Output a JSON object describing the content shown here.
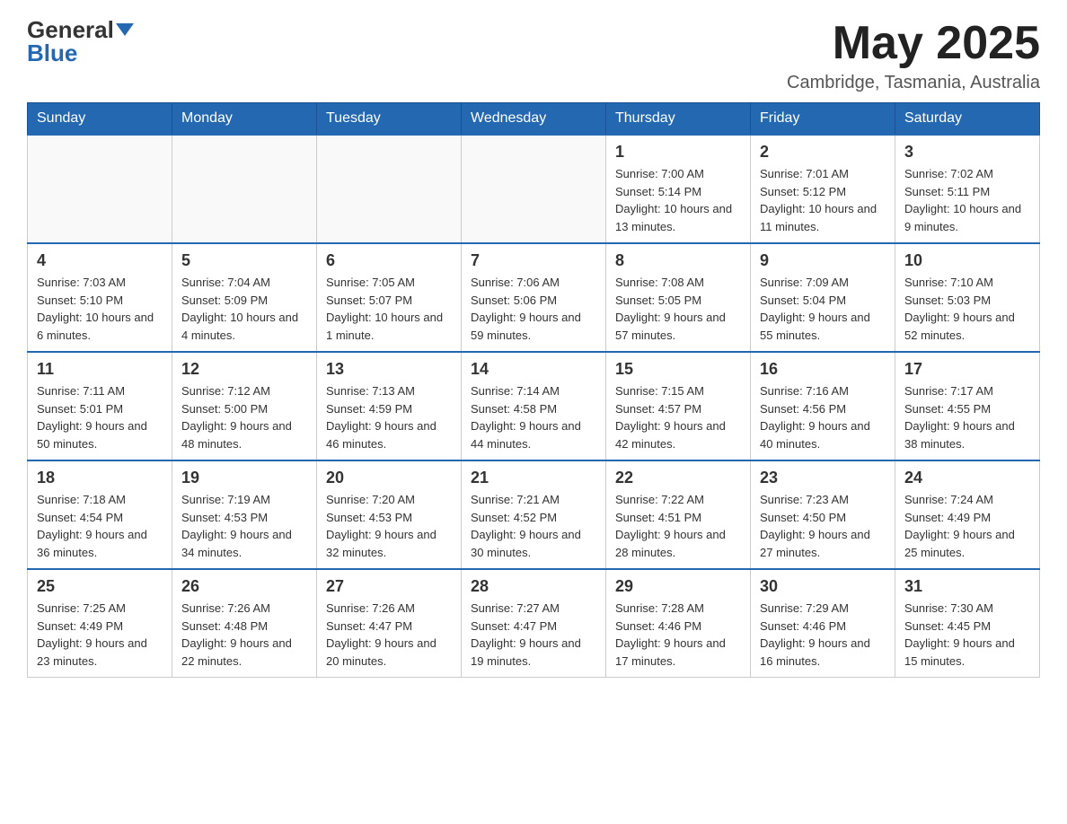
{
  "header": {
    "logo_general": "General",
    "logo_blue": "Blue",
    "month_title": "May 2025",
    "location": "Cambridge, Tasmania, Australia"
  },
  "days_of_week": [
    "Sunday",
    "Monday",
    "Tuesday",
    "Wednesday",
    "Thursday",
    "Friday",
    "Saturday"
  ],
  "weeks": [
    [
      {
        "day": "",
        "info": ""
      },
      {
        "day": "",
        "info": ""
      },
      {
        "day": "",
        "info": ""
      },
      {
        "day": "",
        "info": ""
      },
      {
        "day": "1",
        "info": "Sunrise: 7:00 AM\nSunset: 5:14 PM\nDaylight: 10 hours and 13 minutes."
      },
      {
        "day": "2",
        "info": "Sunrise: 7:01 AM\nSunset: 5:12 PM\nDaylight: 10 hours and 11 minutes."
      },
      {
        "day": "3",
        "info": "Sunrise: 7:02 AM\nSunset: 5:11 PM\nDaylight: 10 hours and 9 minutes."
      }
    ],
    [
      {
        "day": "4",
        "info": "Sunrise: 7:03 AM\nSunset: 5:10 PM\nDaylight: 10 hours and 6 minutes."
      },
      {
        "day": "5",
        "info": "Sunrise: 7:04 AM\nSunset: 5:09 PM\nDaylight: 10 hours and 4 minutes."
      },
      {
        "day": "6",
        "info": "Sunrise: 7:05 AM\nSunset: 5:07 PM\nDaylight: 10 hours and 1 minute."
      },
      {
        "day": "7",
        "info": "Sunrise: 7:06 AM\nSunset: 5:06 PM\nDaylight: 9 hours and 59 minutes."
      },
      {
        "day": "8",
        "info": "Sunrise: 7:08 AM\nSunset: 5:05 PM\nDaylight: 9 hours and 57 minutes."
      },
      {
        "day": "9",
        "info": "Sunrise: 7:09 AM\nSunset: 5:04 PM\nDaylight: 9 hours and 55 minutes."
      },
      {
        "day": "10",
        "info": "Sunrise: 7:10 AM\nSunset: 5:03 PM\nDaylight: 9 hours and 52 minutes."
      }
    ],
    [
      {
        "day": "11",
        "info": "Sunrise: 7:11 AM\nSunset: 5:01 PM\nDaylight: 9 hours and 50 minutes."
      },
      {
        "day": "12",
        "info": "Sunrise: 7:12 AM\nSunset: 5:00 PM\nDaylight: 9 hours and 48 minutes."
      },
      {
        "day": "13",
        "info": "Sunrise: 7:13 AM\nSunset: 4:59 PM\nDaylight: 9 hours and 46 minutes."
      },
      {
        "day": "14",
        "info": "Sunrise: 7:14 AM\nSunset: 4:58 PM\nDaylight: 9 hours and 44 minutes."
      },
      {
        "day": "15",
        "info": "Sunrise: 7:15 AM\nSunset: 4:57 PM\nDaylight: 9 hours and 42 minutes."
      },
      {
        "day": "16",
        "info": "Sunrise: 7:16 AM\nSunset: 4:56 PM\nDaylight: 9 hours and 40 minutes."
      },
      {
        "day": "17",
        "info": "Sunrise: 7:17 AM\nSunset: 4:55 PM\nDaylight: 9 hours and 38 minutes."
      }
    ],
    [
      {
        "day": "18",
        "info": "Sunrise: 7:18 AM\nSunset: 4:54 PM\nDaylight: 9 hours and 36 minutes."
      },
      {
        "day": "19",
        "info": "Sunrise: 7:19 AM\nSunset: 4:53 PM\nDaylight: 9 hours and 34 minutes."
      },
      {
        "day": "20",
        "info": "Sunrise: 7:20 AM\nSunset: 4:53 PM\nDaylight: 9 hours and 32 minutes."
      },
      {
        "day": "21",
        "info": "Sunrise: 7:21 AM\nSunset: 4:52 PM\nDaylight: 9 hours and 30 minutes."
      },
      {
        "day": "22",
        "info": "Sunrise: 7:22 AM\nSunset: 4:51 PM\nDaylight: 9 hours and 28 minutes."
      },
      {
        "day": "23",
        "info": "Sunrise: 7:23 AM\nSunset: 4:50 PM\nDaylight: 9 hours and 27 minutes."
      },
      {
        "day": "24",
        "info": "Sunrise: 7:24 AM\nSunset: 4:49 PM\nDaylight: 9 hours and 25 minutes."
      }
    ],
    [
      {
        "day": "25",
        "info": "Sunrise: 7:25 AM\nSunset: 4:49 PM\nDaylight: 9 hours and 23 minutes."
      },
      {
        "day": "26",
        "info": "Sunrise: 7:26 AM\nSunset: 4:48 PM\nDaylight: 9 hours and 22 minutes."
      },
      {
        "day": "27",
        "info": "Sunrise: 7:26 AM\nSunset: 4:47 PM\nDaylight: 9 hours and 20 minutes."
      },
      {
        "day": "28",
        "info": "Sunrise: 7:27 AM\nSunset: 4:47 PM\nDaylight: 9 hours and 19 minutes."
      },
      {
        "day": "29",
        "info": "Sunrise: 7:28 AM\nSunset: 4:46 PM\nDaylight: 9 hours and 17 minutes."
      },
      {
        "day": "30",
        "info": "Sunrise: 7:29 AM\nSunset: 4:46 PM\nDaylight: 9 hours and 16 minutes."
      },
      {
        "day": "31",
        "info": "Sunrise: 7:30 AM\nSunset: 4:45 PM\nDaylight: 9 hours and 15 minutes."
      }
    ]
  ]
}
